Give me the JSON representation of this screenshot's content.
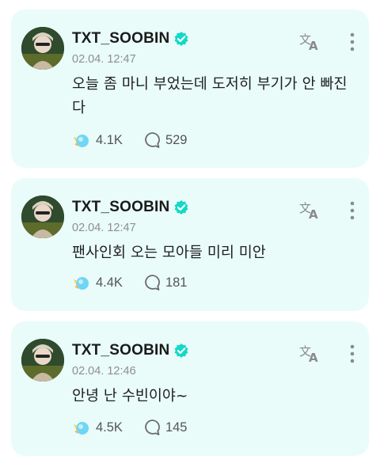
{
  "posts": [
    {
      "author": "TXT_SOOBIN",
      "date": "02.04. 12:47",
      "text": "오늘 좀 마니 부었는데 도저히 부기가 안 빠진다",
      "likes": "4.1K",
      "comments": "529"
    },
    {
      "author": "TXT_SOOBIN",
      "date": "02.04. 12:47",
      "text": "팬사인회 오는 모아들 미리 미안",
      "likes": "4.4K",
      "comments": "181"
    },
    {
      "author": "TXT_SOOBIN",
      "date": "02.04. 12:46",
      "text": "안녕 난 수빈이야~",
      "likes": "4.5K",
      "comments": "145"
    }
  ],
  "colors": {
    "card_bg": "#e9fcf9",
    "verified": "#14d8c8",
    "like_icon": "#6fd6f5"
  }
}
